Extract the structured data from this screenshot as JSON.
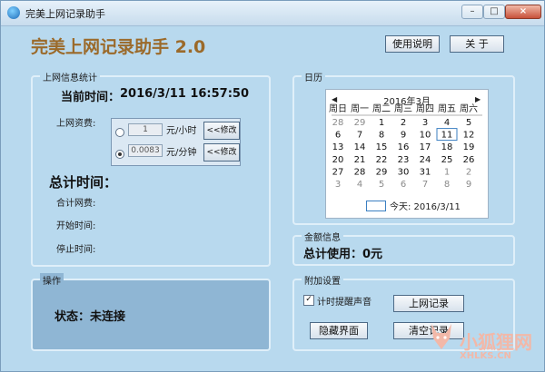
{
  "window": {
    "title": "完美上网记录助手"
  },
  "header": {
    "app_title": "完美上网记录助手 2.0",
    "help_button": "使用说明",
    "about_button": "关 于"
  },
  "stats": {
    "label": "上网信息统计",
    "current_time_label": "当前时间：",
    "current_time_value": "2016/3/11 16:57:50",
    "rate_label": "上网资费:",
    "rate_hour_value": "1",
    "rate_hour_unit": "元/小时",
    "rate_minute_value": "0.0083",
    "rate_minute_unit": "元/分钟",
    "modify_button": "<<修改",
    "selected_rate": "per_minute",
    "total_time_label": "总计时间：",
    "total_fee_label": "合计网费:",
    "start_time_label": "开始时间:",
    "stop_time_label": "停止时间:"
  },
  "calendar": {
    "label": "日历",
    "month_title": "2016年3月",
    "today_text": "今天: 2016/3/11"
  },
  "chart_data": {
    "type": "table",
    "title": "2016年3月",
    "columns": [
      "周日",
      "周一",
      "周二",
      "周三",
      "周四",
      "周五",
      "周六"
    ],
    "rows": [
      [
        "28",
        "29",
        "1",
        "2",
        "3",
        "4",
        "5"
      ],
      [
        "6",
        "7",
        "8",
        "9",
        "10",
        "11",
        "12"
      ],
      [
        "13",
        "14",
        "15",
        "16",
        "17",
        "18",
        "19"
      ],
      [
        "20",
        "21",
        "22",
        "23",
        "24",
        "25",
        "26"
      ],
      [
        "27",
        "28",
        "29",
        "30",
        "31",
        "1",
        "2"
      ],
      [
        "3",
        "4",
        "5",
        "6",
        "7",
        "8",
        "9"
      ]
    ],
    "other_month_cells": [
      [
        0,
        0
      ],
      [
        0,
        1
      ],
      [
        4,
        5
      ],
      [
        4,
        6
      ],
      [
        5,
        0
      ],
      [
        5,
        1
      ],
      [
        5,
        2
      ],
      [
        5,
        3
      ],
      [
        5,
        4
      ],
      [
        5,
        5
      ],
      [
        5,
        6
      ]
    ],
    "selected_cell": [
      1,
      5
    ]
  },
  "money": {
    "label": "金额信息",
    "total_text": "总计使用：0元"
  },
  "operations": {
    "label": "操作",
    "status_text": "状态：未连接"
  },
  "extra": {
    "label": "附加设置",
    "timer_sound_label": "计时提醒声音",
    "timer_sound_checked": true,
    "log_button": "上网记录",
    "hide_button": "隐藏界面",
    "clear_button": "清空记录"
  },
  "watermark": {
    "text": "小狐狸网",
    "url": "XHLKS.CN"
  },
  "colors": {
    "window_bg": "#b8d9ee",
    "title_accent": "#9b6a2a",
    "today_border": "#3b7fc2",
    "other_month": "#8a8a8a"
  }
}
